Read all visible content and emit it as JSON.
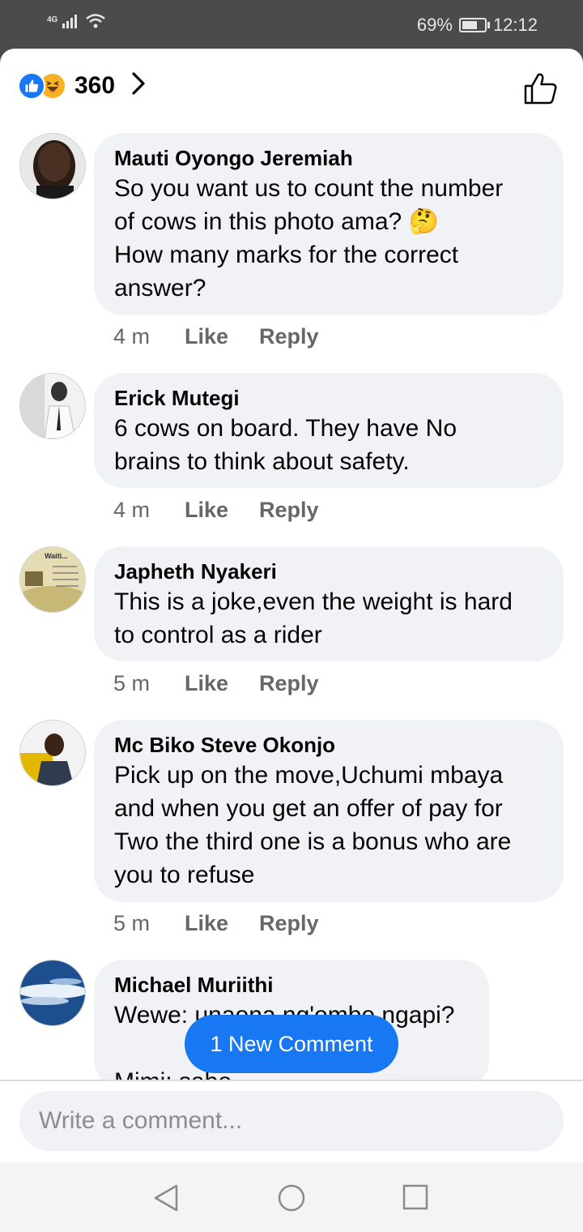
{
  "status_bar": {
    "network": "4G",
    "battery": "69%",
    "battery_level": 0.69,
    "time": "12:12"
  },
  "reactions": {
    "count": "360",
    "icons": [
      "like-icon",
      "haha-icon"
    ]
  },
  "comments": [
    {
      "author": "Mauti Oyongo Jeremiah",
      "text": "So you want us to count the number\nof cows in this photo ama? 🤔\nHow many marks for the correct\nanswer?",
      "time": "4 m",
      "like": "Like",
      "reply": "Reply"
    },
    {
      "author": "Erick Mutegi",
      "text": "6 cows on board. They have No\nbrains to think about safety.",
      "time": "4 m",
      "like": "Like",
      "reply": "Reply"
    },
    {
      "author": "Japheth Nyakeri",
      "text": "This is a joke,even the weight is hard\nto control as a rider",
      "time": "5 m",
      "like": "Like",
      "reply": "Reply"
    },
    {
      "author": "Mc Biko Steve Okonjo",
      "text": "Pick up on the move,Uchumi mbaya\nand when you get an offer of pay for\nTwo the third one is a bonus who are\nyou to refuse",
      "time": "5 m",
      "like": "Like",
      "reply": "Reply"
    },
    {
      "author": "Michael Muriithi",
      "text": "Wewe: unaona ng'ombe ngapi?\n\nMimi: sabo",
      "time": "",
      "like": "",
      "reply": ""
    }
  ],
  "avatar_text": "Waiti...",
  "new_comment_button": "1 New Comment",
  "composer": {
    "placeholder": "Write a comment..."
  },
  "colors": {
    "accent": "#1877f2",
    "bubble": "#f0f2f5",
    "secondary_text": "#65676b"
  }
}
